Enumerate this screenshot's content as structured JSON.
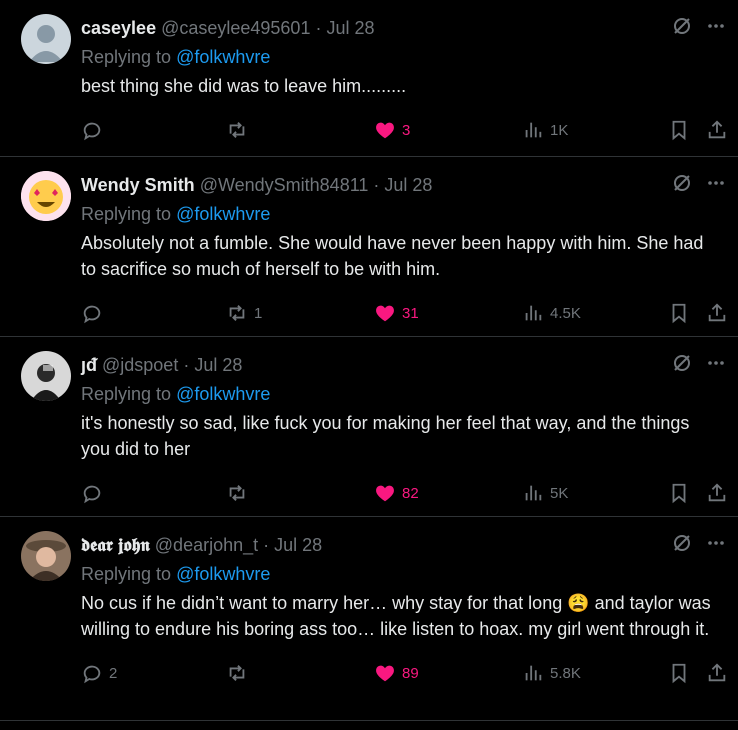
{
  "tweets": [
    {
      "name": "caseylee",
      "handle": "@caseylee495601",
      "date": "· Jul 28",
      "replying_prefix": "Replying to",
      "replying_to": "@folkwhvre",
      "text": "best thing she did was to leave him.........",
      "replies": "",
      "reposts": "",
      "likes": "3",
      "views": "1K",
      "avatar": "default-avatar",
      "bg": "#1e1e1e"
    },
    {
      "name": "Wendy Smith",
      "handle": "@WendySmith84811",
      "date": "· Jul 28",
      "replying_prefix": "Replying to",
      "replying_to": "@folkwhvre",
      "text": "Absolutely not a fumble. She would have never been happy with him. She had to sacrifice so much of herself to be with him.",
      "replies": "",
      "reposts": "1",
      "likes": "31",
      "views": "4.5K",
      "avatar": "heart-eyes-emoji"
    },
    {
      "name": "ȷᵭ",
      "handle": "@jdspoet",
      "date": "· Jul 28",
      "replying_prefix": "Replying to",
      "replying_to": "@folkwhvre",
      "text": "it's honestly so sad, like fuck you for making her feel that way, and the things you did to her",
      "replies": "",
      "reposts": "",
      "likes": "82",
      "views": "5K",
      "avatar": "photo-avatar"
    },
    {
      "name": "𝖉𝖊𝖆𝖗 𝖏𝖔𝖍𝖓",
      "handle": "@dearjohn_t",
      "date": "· Jul 28",
      "replying_prefix": "Replying to",
      "replying_to": "@folkwhvre",
      "text": "No cus if he didn’t want to marry her… why stay for that long 😩 and taylor was willing to endure his boring ass too… like listen to hoax. my girl went through it.",
      "replies": "2",
      "reposts": "",
      "likes": "89",
      "views": "5.8K",
      "avatar": "photo-avatar"
    }
  ],
  "colors": {
    "like": "#f91880",
    "link": "#1d9bf0",
    "muted": "#71767b",
    "text": "#e7e9ea",
    "divider": "#2f3336"
  }
}
